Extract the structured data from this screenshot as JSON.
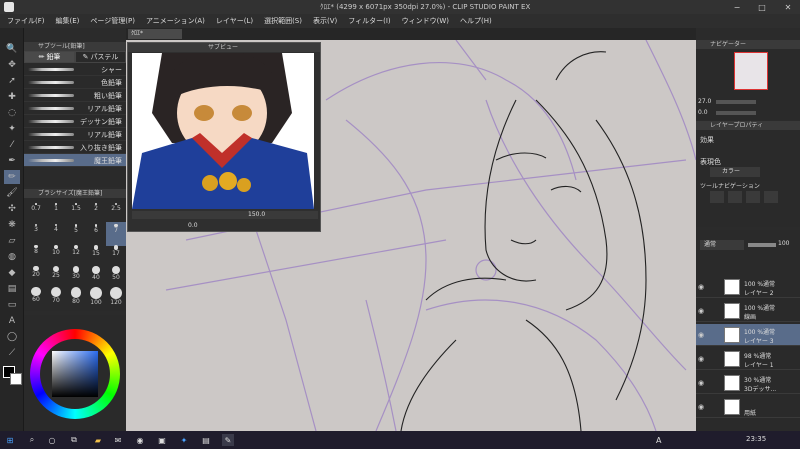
{
  "window": {
    "title": "ｸﾛｴ* (4299 x 6071px 350dpi 27.0%) - CLIP STUDIO PAINT EX",
    "min": "−",
    "max": "□",
    "close": "✕"
  },
  "menu": [
    "ファイル(F)",
    "編集(E)",
    "ページ管理(P)",
    "アニメーション(A)",
    "レイヤー(L)",
    "選択範囲(S)",
    "表示(V)",
    "フィルター(I)",
    "ウィンドウ(W)",
    "ヘルプ(H)"
  ],
  "document_tab": "ｸﾛｴ*",
  "subtool": {
    "header": "サブツール[鉛筆]",
    "tab_pencil": "鉛筆",
    "tab_pastel": "パステル",
    "brushes": [
      "シャー",
      "色鉛筆",
      "粗い鉛筆",
      "リアル鉛筆",
      "デッサン鉛筆",
      "リアル鉛筆",
      "入り抜き鉛筆",
      "魔王鉛筆"
    ],
    "selected_index": 7
  },
  "brush_size": {
    "header": "ブラシサイズ[魔王鉛筆]",
    "sizes": [
      "0.7",
      "1",
      "1.5",
      "2",
      "2.5",
      "3",
      "4",
      "5",
      "6",
      "7",
      "8",
      "10",
      "12",
      "15",
      "17",
      "20",
      "25",
      "30",
      "40",
      "50",
      "60",
      "70",
      "80",
      "100",
      "120"
    ],
    "selected": "7"
  },
  "subview": {
    "header": "サブビュー",
    "zoom": "150.0",
    "rotation": "0.0"
  },
  "navigator": {
    "header": "ナビゲーター",
    "zoom": "27.0",
    "angle": "0.0"
  },
  "layer_property": {
    "header": "レイヤープロパティ",
    "effect_label": "効果",
    "expression_label": "表現色",
    "expression_value": "カラー",
    "ruler_label": "ツールナビゲーション"
  },
  "layer_panel": {
    "blend_mode": "通常",
    "opacity": "100",
    "layers": [
      {
        "line1": "100 %通常",
        "line2": "レイヤー 2",
        "selected": false
      },
      {
        "line1": "100 %通常",
        "line2": "線画",
        "selected": false
      },
      {
        "line1": "100 %通常",
        "line2": "レイヤー 3",
        "selected": true
      },
      {
        "line1": "98 %通常",
        "line2": "レイヤー 1",
        "selected": false
      },
      {
        "line1": "30 %通常",
        "line2": "3Dデッサ...",
        "selected": false
      },
      {
        "line1": "",
        "line2": "用紙",
        "selected": false
      }
    ]
  },
  "color": {
    "main": "#000000",
    "sub": "#ffffff"
  },
  "taskbar": {
    "time": "23:35",
    "ime": "A"
  }
}
